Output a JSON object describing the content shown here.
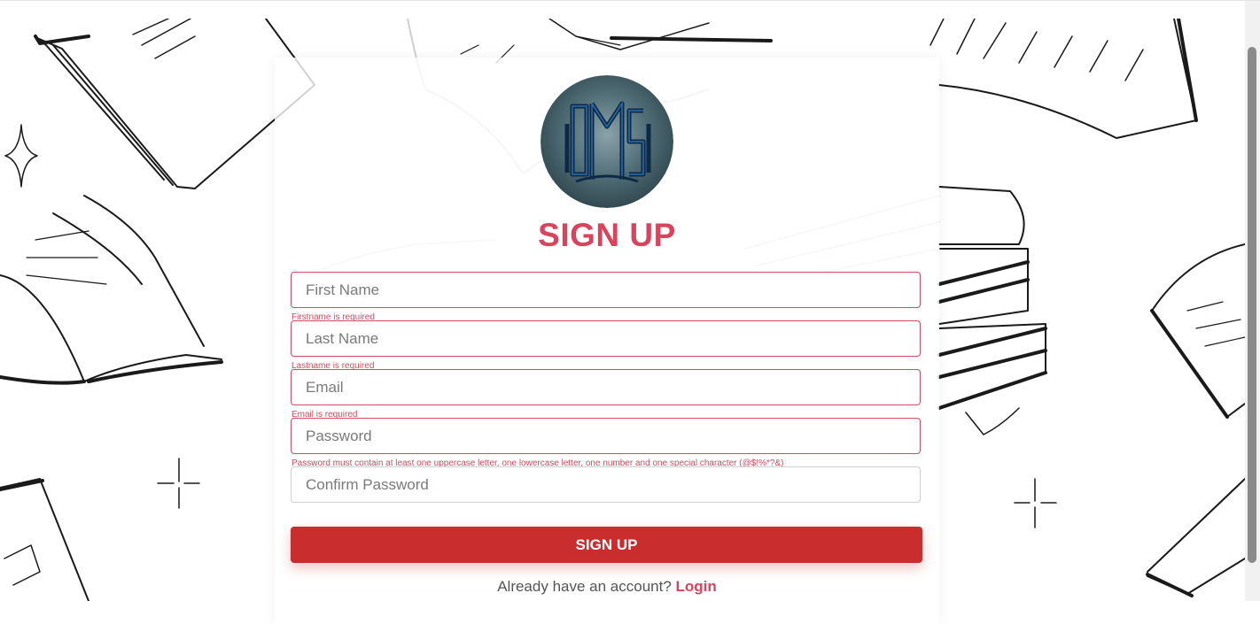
{
  "form": {
    "title": "SIGN UP",
    "first_name": {
      "placeholder": "First Name",
      "value": "",
      "error": "Firstname is required"
    },
    "last_name": {
      "placeholder": "Last Name",
      "value": "",
      "error": "Lastname is required"
    },
    "email": {
      "placeholder": "Email",
      "value": "",
      "error": "Email is required"
    },
    "password": {
      "placeholder": "Password",
      "value": "",
      "error": "Password must contain at least one uppercase letter, one lowercase letter, one number and one special character (@$!%*?&)"
    },
    "confirm_password": {
      "placeholder": "Confirm Password",
      "value": ""
    },
    "submit_label": "SIGN UP",
    "login_prompt": "Already have an account?",
    "login_link": "Login"
  },
  "logo": {
    "alt": "OMS"
  },
  "colors": {
    "accent": "#d9435b",
    "button": "#c92d2d",
    "error": "#d44a5f",
    "logo_bg": "#3f5c66"
  }
}
